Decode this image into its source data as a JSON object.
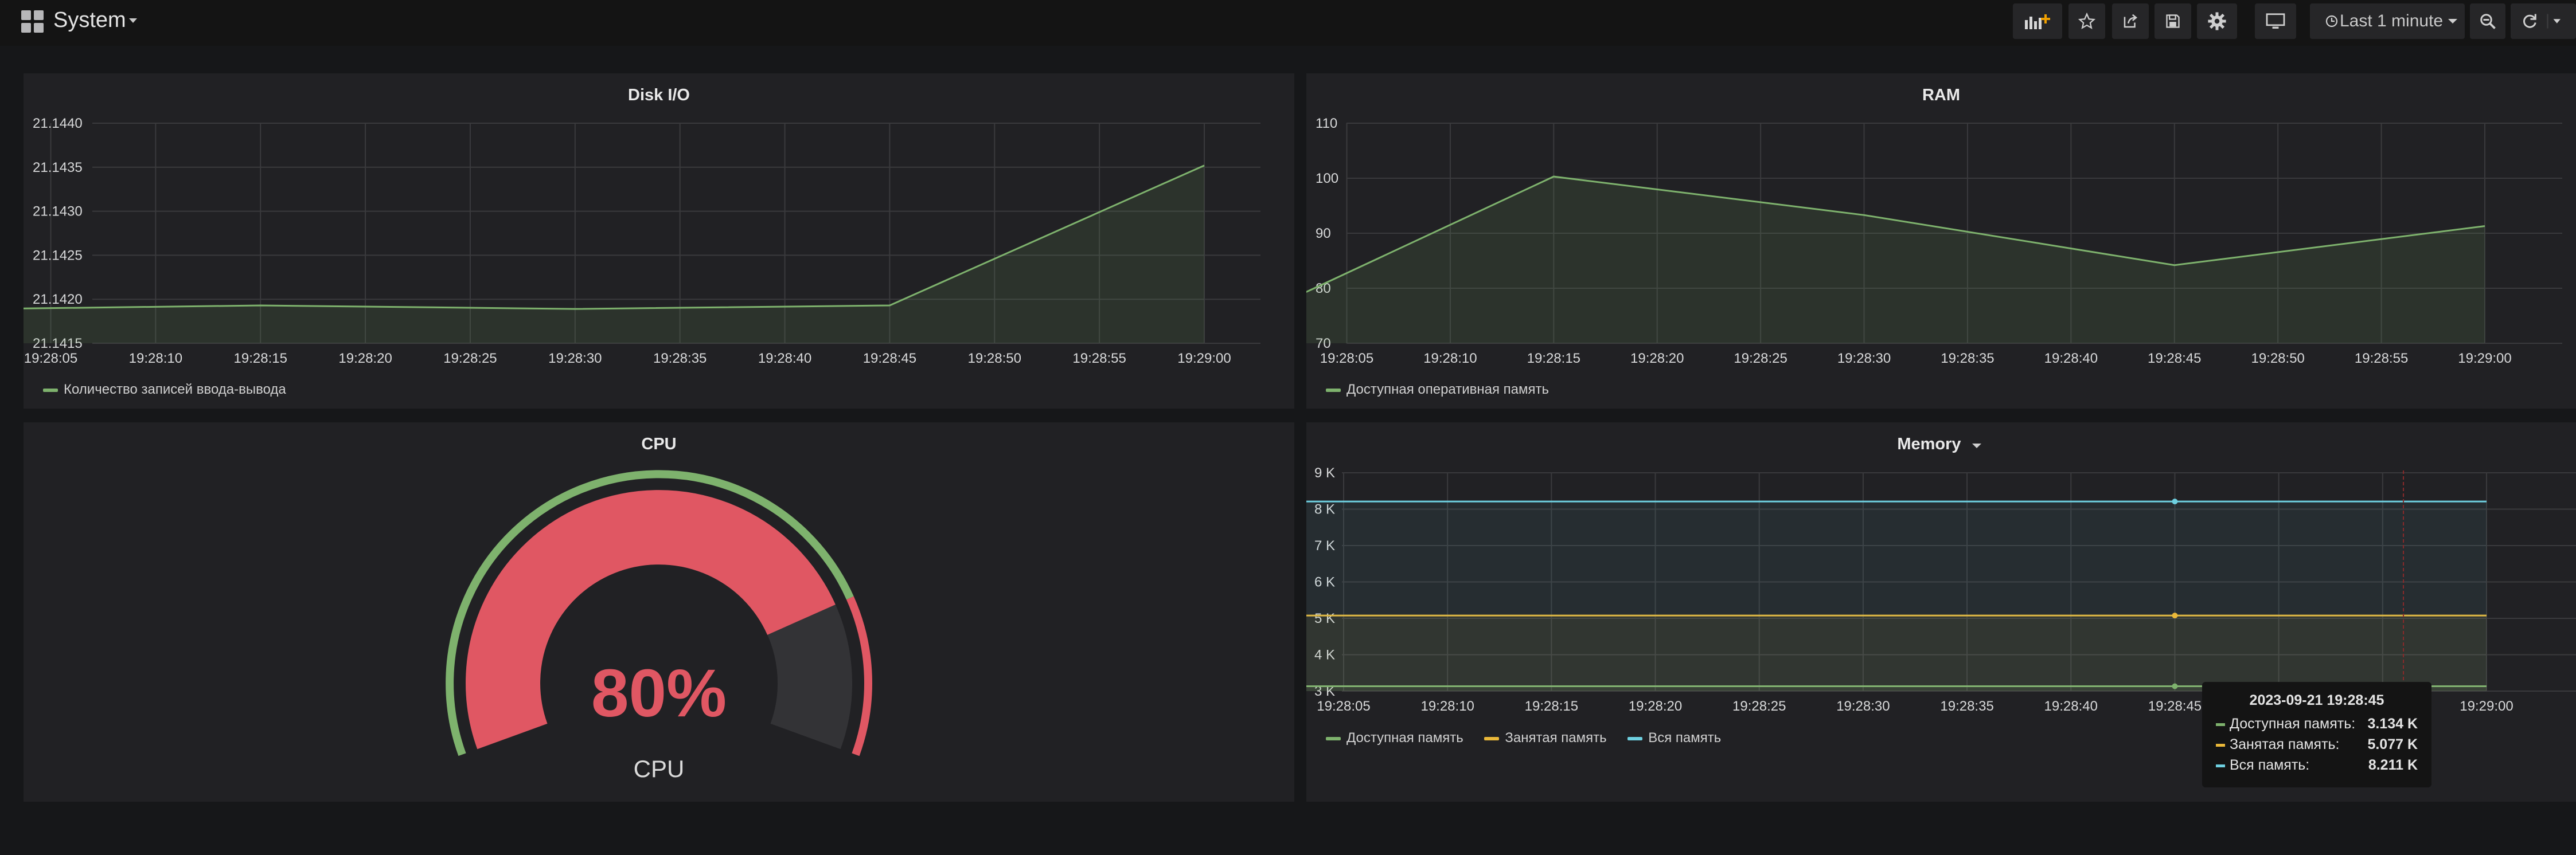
{
  "navbar": {
    "title": "System",
    "time_range": "Last 1 minute",
    "icons": [
      "grid-icon",
      "add-panel-icon",
      "star-icon",
      "share-icon",
      "save-icon",
      "gear-icon",
      "tv-icon",
      "clock-icon",
      "zoom-out-icon",
      "refresh-icon"
    ]
  },
  "colors": {
    "green": "#7eb26d",
    "yellow": "#eab839",
    "blue": "#6ed0e0",
    "red": "#e05763"
  },
  "disk": {
    "title": "Disk I/O",
    "legend": "Количество записей ввода-вывода"
  },
  "ram": {
    "title": "RAM",
    "legend": "Доступная оперативная память"
  },
  "cpu": {
    "title": "CPU",
    "value": "80%",
    "label": "CPU"
  },
  "memory": {
    "title": "Memory",
    "legend": [
      "Доступная память",
      "Занятая память",
      "Вся память"
    ]
  },
  "tooltip": {
    "time": "2023-09-21 19:28:45",
    "rows": [
      {
        "label": "Доступная память:",
        "value": "3.134 K"
      },
      {
        "label": "Занятая память:",
        "value": "5.077 K"
      },
      {
        "label": "Вся память:",
        "value": "8.211 K"
      }
    ]
  },
  "chart_data": [
    {
      "type": "area",
      "title": "Disk I/O",
      "x": [
        "19:28:05",
        "19:28:10",
        "19:28:15",
        "19:28:20",
        "19:28:25",
        "19:28:30",
        "19:28:35",
        "19:28:40",
        "19:28:45",
        "19:28:50",
        "19:28:55",
        "19:29:00"
      ],
      "y_ticks": [
        "21.1440",
        "21.1435",
        "21.1430",
        "21.1425",
        "21.1420",
        "21.1415"
      ],
      "ylim": [
        21.1415,
        21.144
      ],
      "series": [
        {
          "name": "Количество записей ввода-вывода",
          "points": [
            [
              "19:28:02",
              21.14189
            ],
            [
              "19:28:15",
              21.14193
            ],
            [
              "19:28:30",
              21.14189
            ],
            [
              "19:28:45",
              21.14193
            ],
            [
              "19:29:00",
              21.14352
            ]
          ]
        }
      ]
    },
    {
      "type": "area",
      "title": "RAM",
      "x": [
        "19:28:05",
        "19:28:10",
        "19:28:15",
        "19:28:20",
        "19:28:25",
        "19:28:30",
        "19:28:35",
        "19:28:40",
        "19:28:45",
        "19:28:50",
        "19:28:55",
        "19:29:00"
      ],
      "y_ticks": [
        "110",
        "100",
        "90",
        "80",
        "70"
      ],
      "ylim": [
        70,
        110
      ],
      "series": [
        {
          "name": "Доступная оперативная память",
          "points": [
            [
              "19:28:02",
              77.5
            ],
            [
              "19:28:15",
              100.3
            ],
            [
              "19:28:30",
              93.3
            ],
            [
              "19:28:45",
              84.2
            ],
            [
              "19:29:00",
              91.3
            ]
          ]
        }
      ]
    },
    {
      "type": "gauge",
      "title": "CPU",
      "value": 80,
      "max": 100,
      "threshold": 80
    },
    {
      "type": "area",
      "title": "Memory",
      "x": [
        "19:28:05",
        "19:28:10",
        "19:28:15",
        "19:28:20",
        "19:28:25",
        "19:28:30",
        "19:28:35",
        "19:28:40",
        "19:28:45",
        "19:28:50",
        "19:28:55",
        "19:29:00"
      ],
      "y_ticks": [
        "9 K",
        "8 K",
        "7 K",
        "6 K",
        "5 K",
        "4 K",
        "3 K"
      ],
      "ylim": [
        3000,
        9000
      ],
      "series": [
        {
          "name": "Доступная память",
          "points": [
            [
              "19:28:02",
              3134
            ],
            [
              "19:29:00",
              3134
            ]
          ]
        },
        {
          "name": "Занятая память",
          "points": [
            [
              "19:28:02",
              5077
            ],
            [
              "19:29:00",
              5077
            ]
          ]
        },
        {
          "name": "Вся память",
          "points": [
            [
              "19:28:02",
              8211
            ],
            [
              "19:29:00",
              8211
            ]
          ]
        }
      ]
    }
  ]
}
